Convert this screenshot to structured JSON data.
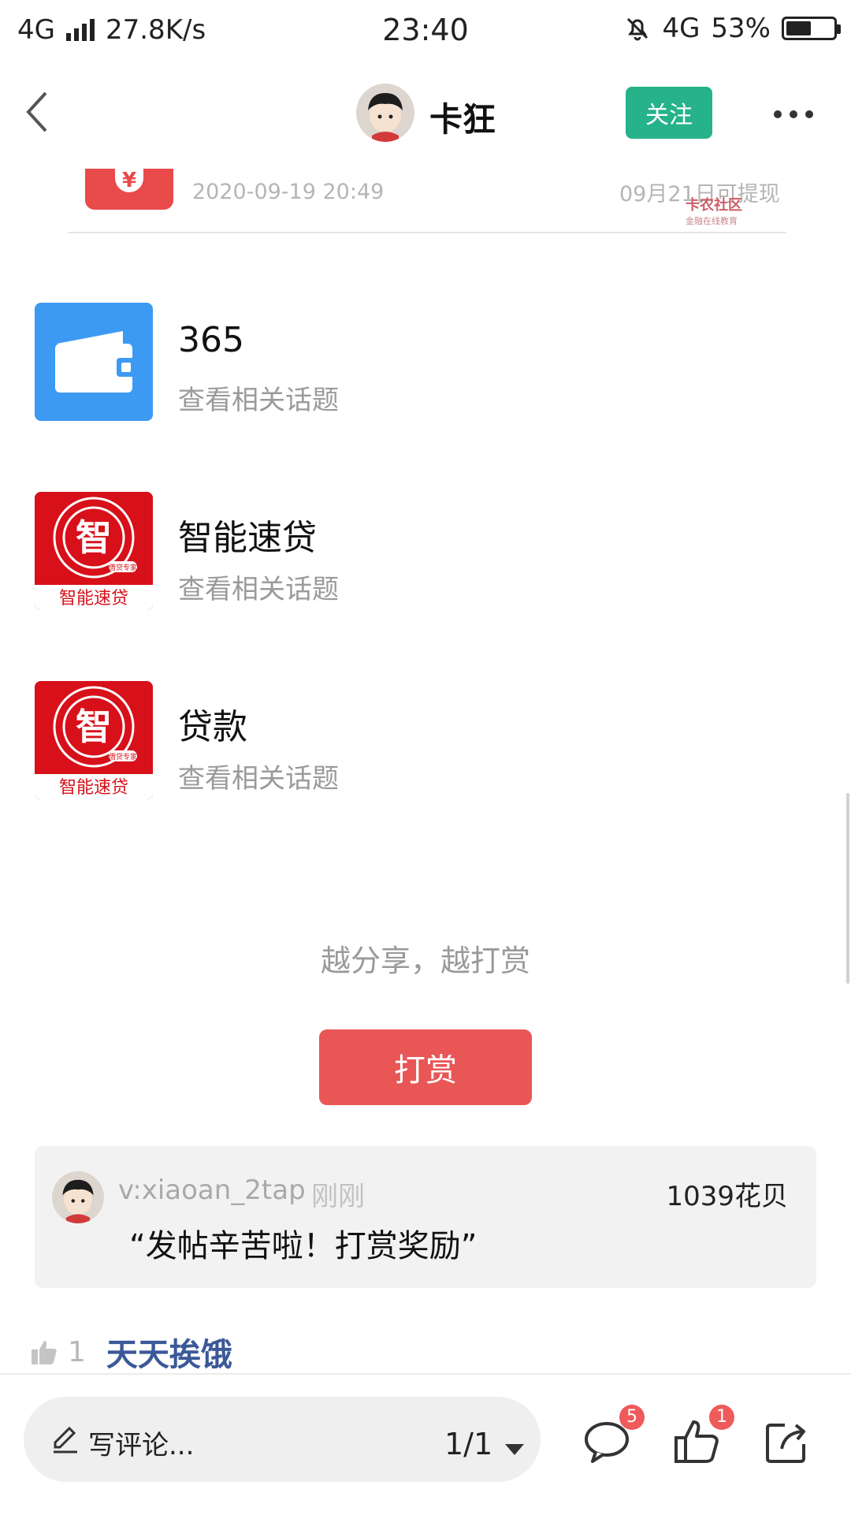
{
  "status_bar": {
    "network_left": "4G",
    "speed": "27.8K/s",
    "time": "23:40",
    "network_right": "4G",
    "battery_text": "53%",
    "battery_level": 0.53
  },
  "header": {
    "author_name": "卡狂",
    "follow_label": "关注"
  },
  "cropped_item": {
    "date": "2020-09-19 20:49",
    "withdraw_note": "09月21日可提现",
    "watermark_title": "卡农社区",
    "watermark_sub": "金融在线教育"
  },
  "topics": [
    {
      "name": "365",
      "sub": "查看相关话题",
      "icon": "wallet-icon"
    },
    {
      "name": "智能速贷",
      "sub": "查看相关话题",
      "icon": "zhi-logo-icon",
      "logo_text": "智能速贷",
      "logo_char": "智",
      "logo_badge": "借贷专家"
    },
    {
      "name": "贷款",
      "sub": "查看相关话题",
      "icon": "zhi-logo-icon",
      "logo_text": "智能速贷",
      "logo_char": "智",
      "logo_badge": "借贷专家"
    }
  ],
  "reward": {
    "prompt": "越分享，越打赏",
    "button_label": "打赏",
    "user": "v:xiaoan_2tap",
    "time": "刚刚",
    "amount": "1039花贝",
    "message": "“发帖辛苦啦！打赏奖励”"
  },
  "likes": {
    "count": "1",
    "first_user": "天天挨饿"
  },
  "bottom_bar": {
    "comment_placeholder": "写评论...",
    "page_indicator": "1/1",
    "comment_badge": "5",
    "like_badge": "1"
  },
  "colors": {
    "follow_green": "#26b38a",
    "reward_red": "#e85656",
    "badge_red": "#ef5a5a",
    "link_blue": "#3b5998"
  }
}
